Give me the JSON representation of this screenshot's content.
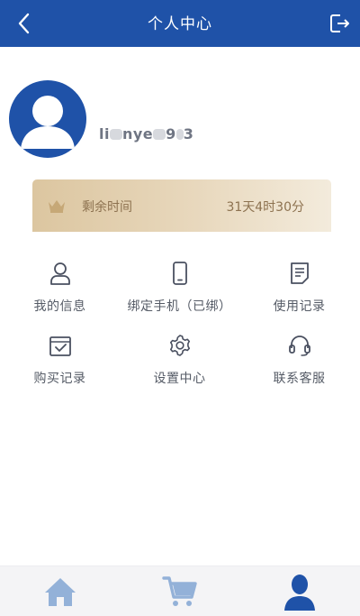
{
  "header": {
    "title": "个人中心",
    "back_icon": "chevron-left-icon",
    "logout_icon": "logout-icon",
    "color": "#1f52a8"
  },
  "profile": {
    "avatar_icon": "user-avatar-icon",
    "username_parts": [
      "li",
      "nye",
      "9",
      "3"
    ]
  },
  "membership": {
    "icon": "crown-icon",
    "label": "剩余时间",
    "value": "31天4时30分"
  },
  "menu": {
    "items": [
      {
        "label": "我的信息",
        "icon": "user-icon"
      },
      {
        "label": "绑定手机（已绑）",
        "icon": "phone-icon"
      },
      {
        "label": "使用记录",
        "icon": "document-icon"
      },
      {
        "label": "购买记录",
        "icon": "purchase-record-icon"
      },
      {
        "label": "设置中心",
        "icon": "gear-icon"
      },
      {
        "label": "联系客服",
        "icon": "headset-icon"
      }
    ]
  },
  "tabbar": {
    "tabs": [
      {
        "icon": "home-icon",
        "active": false
      },
      {
        "icon": "cart-icon",
        "active": false
      },
      {
        "icon": "person-icon",
        "active": true
      }
    ],
    "inactive_color": "#93b1d8",
    "active_color": "#1f52a8"
  }
}
